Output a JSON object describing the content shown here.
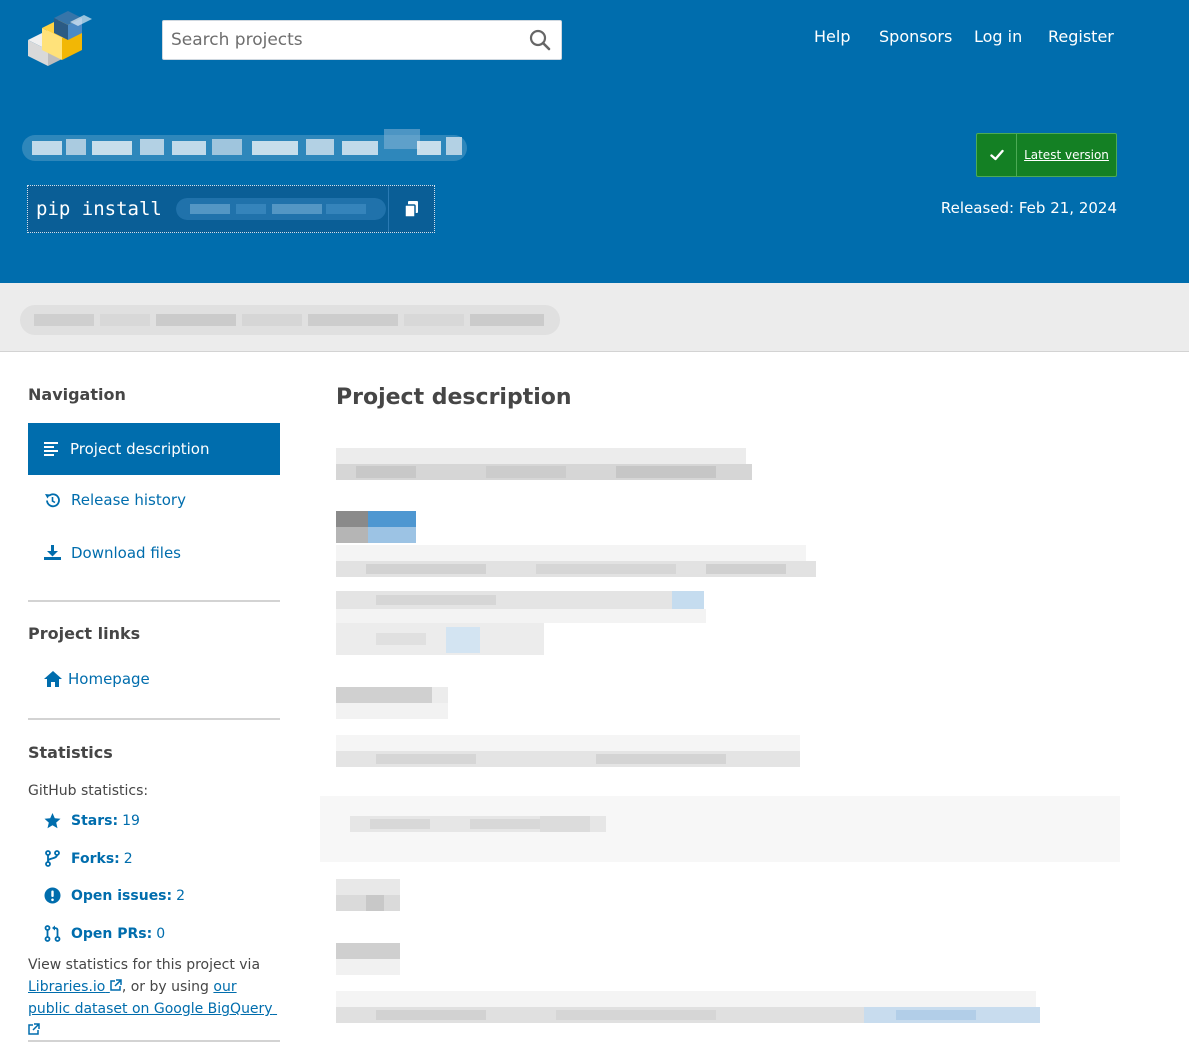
{
  "header": {
    "search_placeholder": "Search projects",
    "links": [
      "Help",
      "Sponsors",
      "Log in",
      "Register"
    ]
  },
  "banner": {
    "pip_command": "pip install",
    "latest_version_label": "Latest version",
    "released": "Released: Feb 21, 2024"
  },
  "sidebar": {
    "navigation_heading": "Navigation",
    "nav_items": [
      "Project description",
      "Release history",
      "Download files"
    ],
    "project_links_heading": "Project links",
    "homepage_label": "Homepage",
    "statistics_heading": "Statistics",
    "github_label": "GitHub statistics:",
    "stats": [
      {
        "label": "Stars:",
        "value": "19"
      },
      {
        "label": "Forks:",
        "value": "2"
      },
      {
        "label": "Open issues:",
        "value": "2"
      },
      {
        "label": "Open PRs:",
        "value": "0"
      }
    ],
    "stats_text_1": "View statistics for this project via",
    "stats_link_1": "Libraries.io",
    "stats_text_2": ", or by using",
    "stats_link_2": "our public dataset on Google BigQuery"
  },
  "main": {
    "heading": "Project description"
  },
  "colors": {
    "brand_blue": "#006dad",
    "latest_green": "#148024",
    "summary_gray": "#ececec"
  }
}
